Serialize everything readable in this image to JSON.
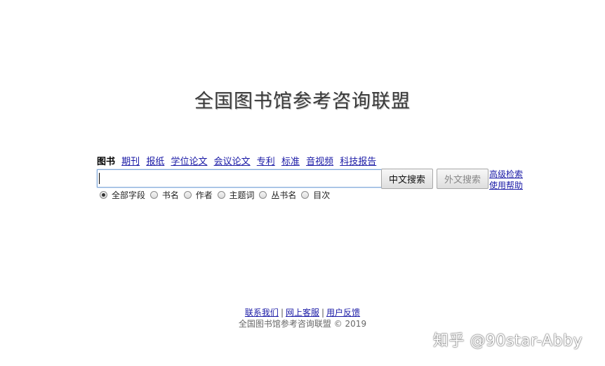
{
  "header": {
    "title": "全国图书馆参考咨询联盟"
  },
  "tabs": [
    {
      "label": "图书",
      "active": true
    },
    {
      "label": "期刊"
    },
    {
      "label": "报纸"
    },
    {
      "label": "学位论文"
    },
    {
      "label": "会议论文"
    },
    {
      "label": "专利"
    },
    {
      "label": "标准"
    },
    {
      "label": "音视频"
    },
    {
      "label": "科技报告"
    }
  ],
  "search": {
    "value": "",
    "chinese_button": "中文搜索",
    "foreign_button": "外文搜索",
    "advanced_link": "高级检索",
    "help_link": "使用帮助"
  },
  "fields": [
    {
      "label": "全部字段",
      "checked": true
    },
    {
      "label": "书名"
    },
    {
      "label": "作者"
    },
    {
      "label": "主题词"
    },
    {
      "label": "丛书名"
    },
    {
      "label": "目次"
    }
  ],
  "footer": {
    "links": [
      "联系我们",
      "网上客服",
      "用户反馈"
    ],
    "separator": "|",
    "copyright": "全国图书馆参考咨询联盟 © 2019"
  },
  "watermark": "知乎 @90star-Abby"
}
